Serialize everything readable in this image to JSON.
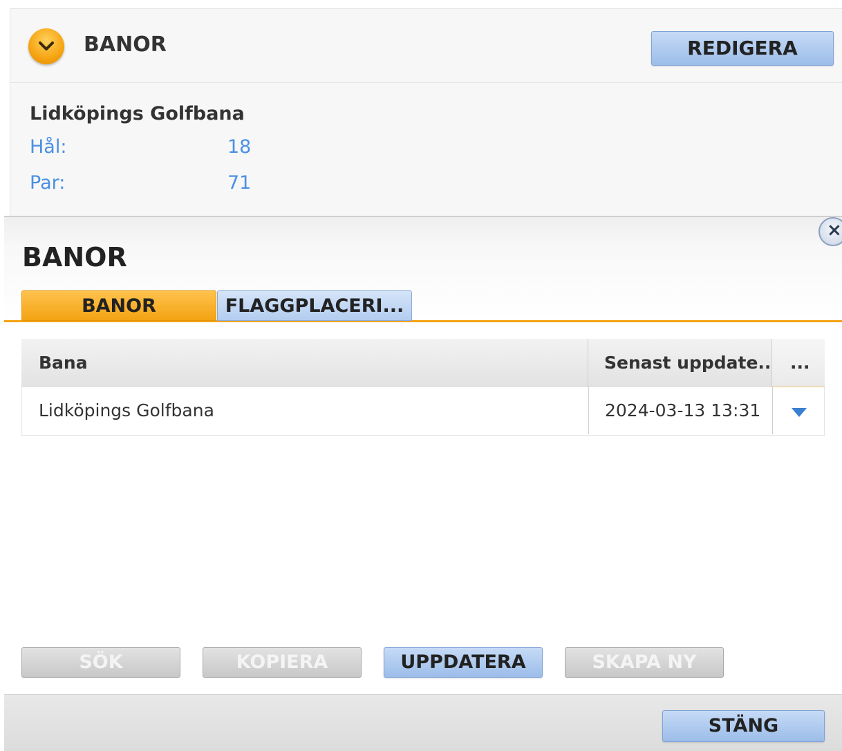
{
  "top": {
    "title": "BANOR",
    "edit_label": "REDIGERA",
    "course_name": "Lidköpings Golfbana",
    "holes_label": "Hål:",
    "holes_value": "18",
    "par_label": "Par:",
    "par_value": "71"
  },
  "dialog": {
    "title": "BANOR",
    "tabs": [
      {
        "label": "BANOR",
        "active": true
      },
      {
        "label": "FLAGGPLACERI...",
        "active": false
      }
    ],
    "table": {
      "columns": [
        "Bana",
        "Senast uppdate...",
        "..."
      ],
      "rows": [
        {
          "bana": "Lidköpings Golfbana",
          "updated": "2024-03-13 13:31"
        }
      ]
    },
    "buttons": {
      "search": "SÖK",
      "copy": "KOPIERA",
      "update": "UPPDATERA",
      "create": "SKAPA NY"
    },
    "close_label": "STÄNG"
  },
  "colors": {
    "accent_orange": "#f3a313",
    "button_blue": "#9cbde9",
    "link_blue": "#4a90e2"
  },
  "icons": {
    "expand": "chevron-down-icon",
    "close": "close-icon",
    "row_menu": "caret-down-icon"
  }
}
